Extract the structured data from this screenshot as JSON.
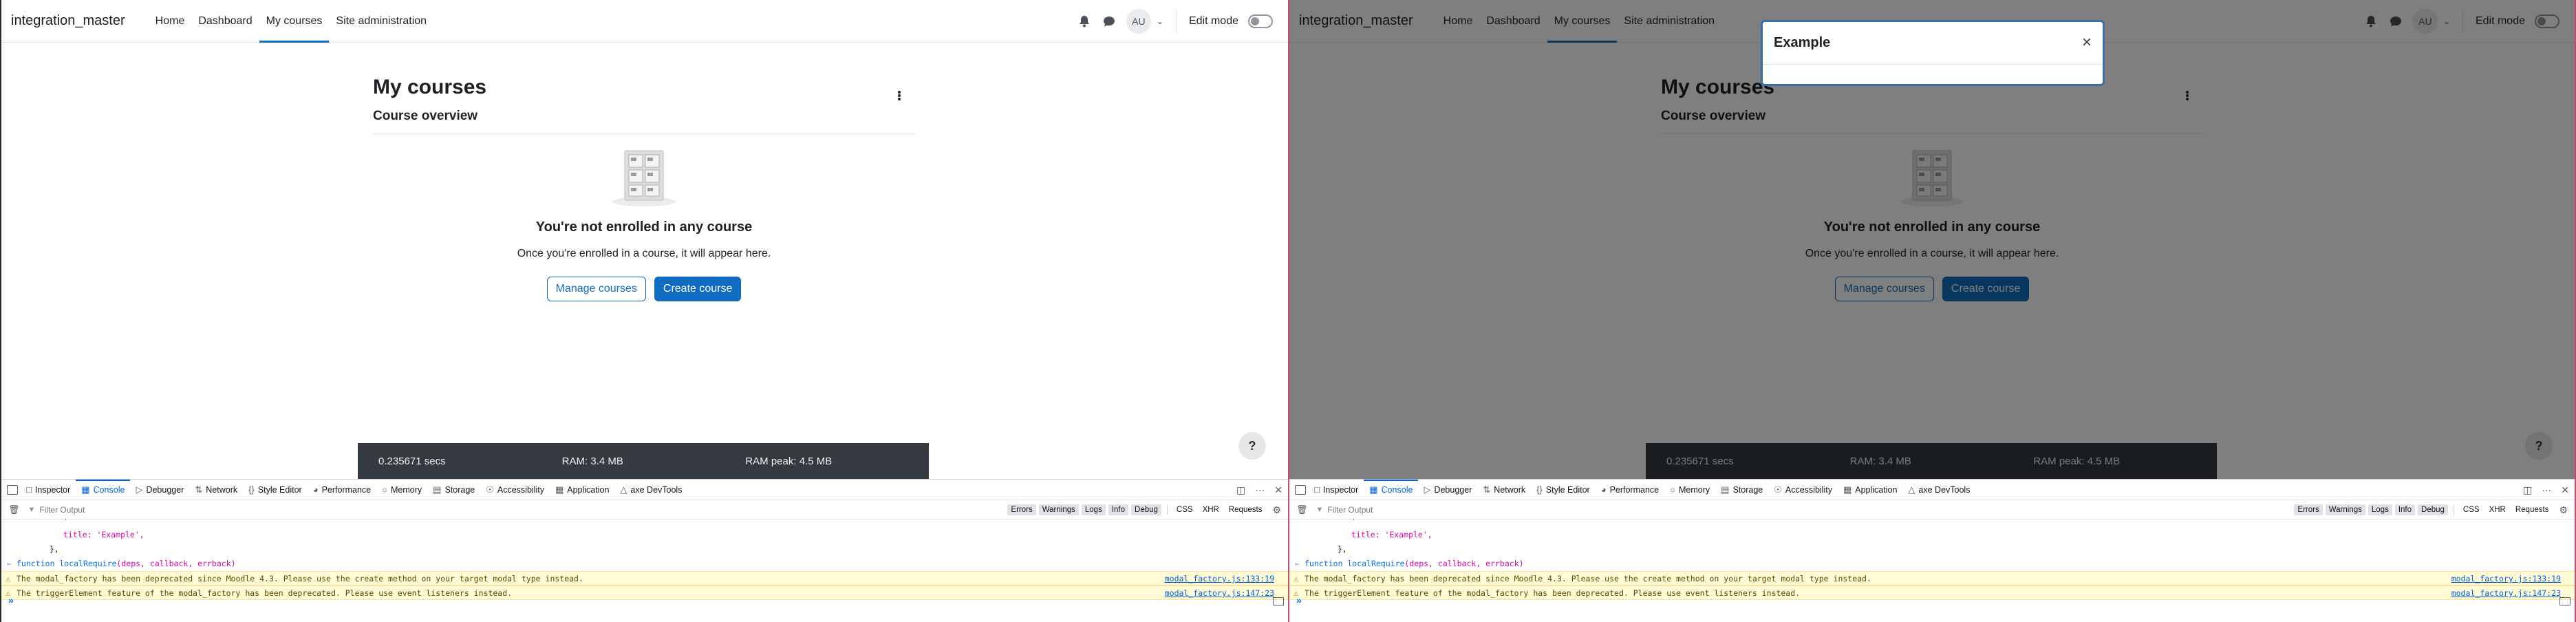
{
  "site": {
    "brand": "integration_master",
    "nav": [
      "Home",
      "Dashboard",
      "My courses",
      "Site administration"
    ],
    "active_nav": "My courses",
    "avatar_initials": "AU",
    "edit_mode_label": "Edit mode"
  },
  "page": {
    "title": "My courses",
    "block_title": "Course overview",
    "empty_title": "You're not enrolled in any course",
    "empty_text": "Once you're enrolled in a course, it will appear here.",
    "manage_button": "Manage courses",
    "create_button": "Create course",
    "help_label": "?"
  },
  "perf": {
    "time": "0.235671 secs",
    "ram": "RAM: 3.4 MB",
    "ram_peak": "RAM peak: 4.5 MB"
  },
  "modal": {
    "title": "Example",
    "close": "×"
  },
  "devtools": {
    "tabs": [
      "Inspector",
      "Console",
      "Debugger",
      "Network",
      "Style Editor",
      "Performance",
      "Memory",
      "Storage",
      "Accessibility",
      "Application",
      "axe DevTools"
    ],
    "active_tab": "Console",
    "filter_placeholder": "Filter Output",
    "levels": [
      "Errors",
      "Warnings",
      "Logs",
      "Info",
      "Debug"
    ],
    "types": [
      "CSS",
      "XHR",
      "Requests"
    ],
    "lines": {
      "l1": "title: 'Example',",
      "l2": "},",
      "l3_fn": "function",
      "l3_name": "localRequire",
      "l3_args": "(deps, callback, errback)",
      "w1": "The modal_factory has been deprecated since Moodle 4.3. Please use the create method on your target modal type instead.",
      "w1_src": "modal_factory.js:133:19",
      "w2": "The triggerElement feature of the modal_factory has been deprecated. Please use event listeners instead.",
      "w2_src": "modal_factory.js:147:23"
    }
  },
  "colors": {
    "primary": "#0f6cbf",
    "perf_bg": "#343a40",
    "devtools_accent": "#0061e0",
    "warning_bg": "#fffbd6"
  }
}
